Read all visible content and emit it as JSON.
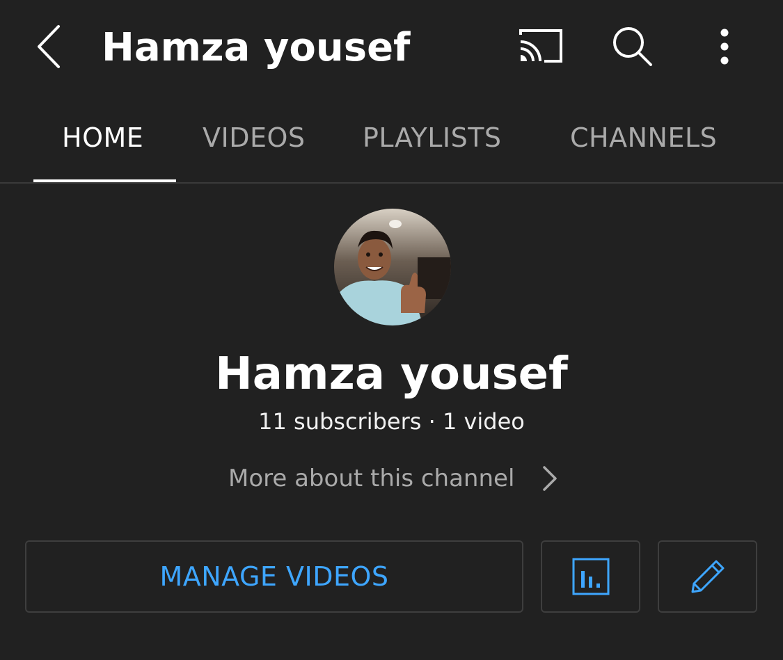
{
  "header": {
    "title": "Hamza yousef",
    "back_icon": "chevron-left-icon",
    "cast_icon": "cast-icon",
    "search_icon": "search-icon",
    "more_icon": "more-vertical-icon"
  },
  "tabs": [
    {
      "label": "HOME",
      "active": true
    },
    {
      "label": "VIDEOS",
      "active": false
    },
    {
      "label": "PLAYLISTS",
      "active": false
    },
    {
      "label": "CHANNELS",
      "active": false
    }
  ],
  "channel": {
    "name": "Hamza yousef",
    "stats": "11 subscribers · 1 video",
    "more_about": "More about this channel"
  },
  "actions": {
    "manage_videos": "MANAGE VIDEOS",
    "analytics_icon": "analytics-icon",
    "edit_icon": "pencil-icon"
  },
  "colors": {
    "background": "#212121",
    "accent": "#3ea6ff",
    "tab_inactive": "#aaaaaa",
    "border": "#3e3e3e"
  }
}
